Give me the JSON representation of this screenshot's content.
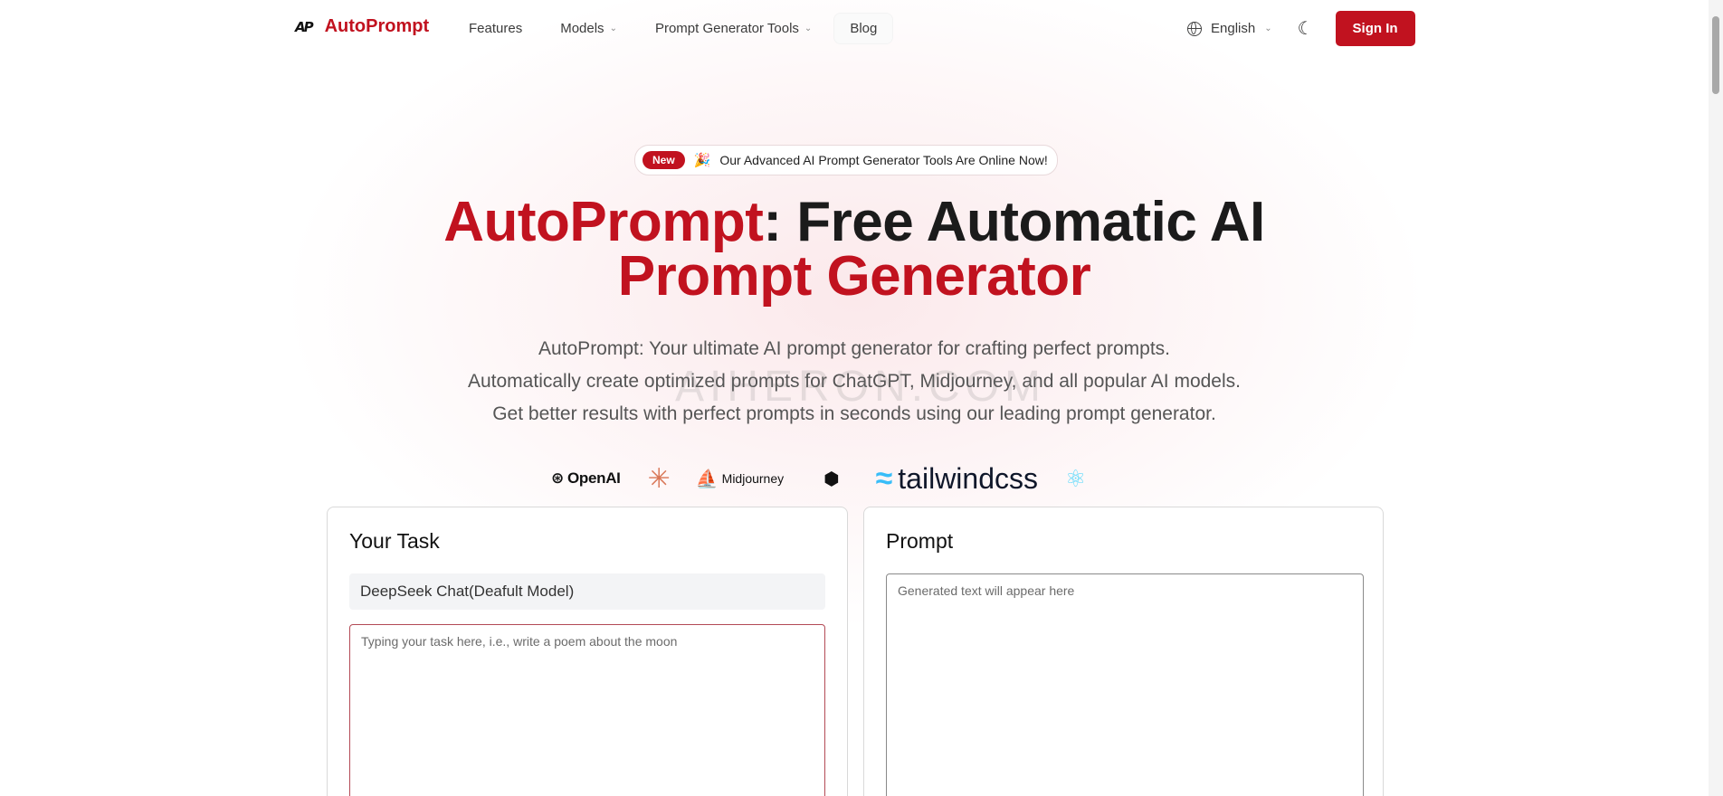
{
  "nav": {
    "logo_mark": "AP",
    "brand": "AutoPrompt",
    "links": [
      {
        "label": "Features",
        "has_dropdown": false
      },
      {
        "label": "Models",
        "has_dropdown": true
      },
      {
        "label": "Prompt Generator Tools",
        "has_dropdown": true
      },
      {
        "label": "Blog",
        "has_dropdown": false
      }
    ],
    "language": "English",
    "theme_icon": "moon-icon",
    "signin_label": "Sign In"
  },
  "announcement": {
    "tag": "New",
    "icon": "party-popper-icon",
    "text": "Our Advanced AI Prompt Generator Tools Are Online Now!"
  },
  "hero": {
    "title_brand": "AutoPrompt",
    "title_rest": ": Free Automatic AI",
    "title_line2": "Prompt Generator",
    "description": [
      "AutoPrompt: Your ultimate AI prompt generator for crafting perfect prompts.",
      "Automatically create optimized prompts for ChatGPT, Midjourney, and all popular AI models.",
      "Get better results with perfect prompts in seconds using our leading prompt generator."
    ],
    "watermark": "AIHERON.COM"
  },
  "logos": {
    "openai": "OpenAI",
    "midjourney": "Midjourney",
    "tailwind": "tailwindcss"
  },
  "task_panel": {
    "title": "Your Task",
    "model": "DeepSeek Chat(Deafult Model)",
    "placeholder": "Typing your task here, i.e., write a poem about the moon"
  },
  "prompt_panel": {
    "title": "Prompt",
    "placeholder": "Generated text will appear here"
  },
  "colors": {
    "brand_red": "#c1121f"
  }
}
